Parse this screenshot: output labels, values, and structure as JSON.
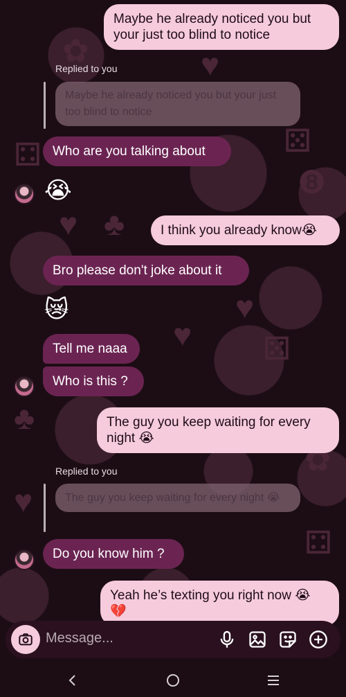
{
  "messages": {
    "m1": "Maybe he already noticed you but your just too blind to notice",
    "replied1": "Replied to you",
    "quote1": "Maybe he already noticed you but your just too blind to notice",
    "m2": "Who are you talking about",
    "emoji1": "😭",
    "m3": "I think you already know",
    "m3_emoji": "😭",
    "m4": "Bro please don't joke about it",
    "emoji2": "😿",
    "m5": "Tell me naaa",
    "m6": "Who is this ?",
    "m7": "The guy you keep waiting for every night",
    "m7_emoji": "😭",
    "replied2": "Replied to you",
    "quote2": "The guy you keep waiting for every night",
    "quote2_emoji": "😭",
    "m8": "Do you know him ?",
    "m9": "Yeah he’s texting you right now",
    "m9_emoji": "😭",
    "m9_emoji2": "💔"
  },
  "composer": {
    "placeholder": "Message..."
  },
  "colors": {
    "sent_bubble": "#f6cbdc",
    "received_bubble": "#6b2452",
    "background": "#1c0d14"
  },
  "icons": [
    "camera-icon",
    "mic-icon",
    "gallery-icon",
    "sticker-icon",
    "plus-icon",
    "back-nav-icon",
    "home-nav-icon",
    "recents-nav-icon"
  ]
}
